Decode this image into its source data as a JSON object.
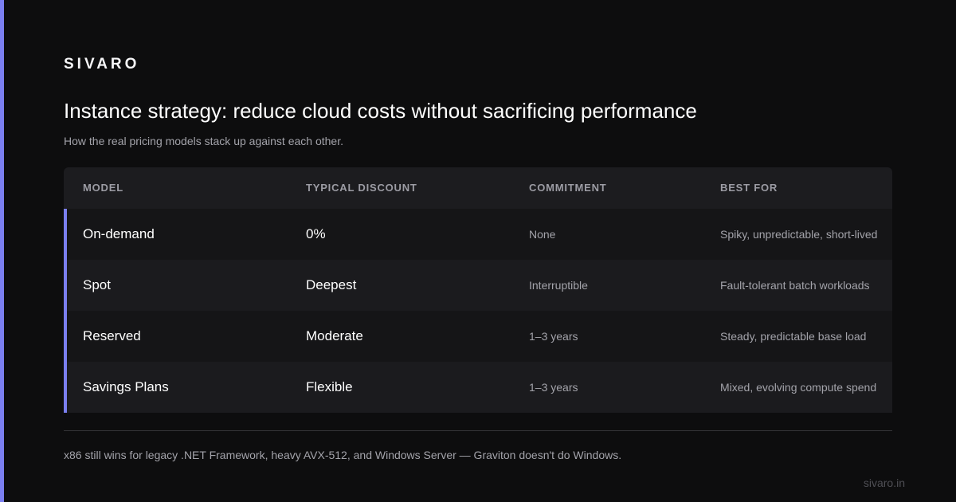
{
  "brand": "SIVARO",
  "title": "Instance strategy: reduce cloud costs without sacrificing performance",
  "subtitle": "How the real pricing models stack up against each other.",
  "colors": {
    "background": "#0d0d0e",
    "accent": "#7b7ff0",
    "header_bg": "#1c1c1f",
    "row_odd": "#151517",
    "row_even": "#1b1b1e"
  },
  "table": {
    "headers": [
      "MODEL",
      "TYPICAL DISCOUNT",
      "COMMITMENT",
      "BEST FOR"
    ],
    "rows": [
      {
        "model": "On-demand",
        "discount": "0%",
        "commitment": "None",
        "best_for": "Spiky, unpredictable, short-lived"
      },
      {
        "model": "Spot",
        "discount": "Deepest",
        "commitment": "Interruptible",
        "best_for": "Fault-tolerant batch workloads"
      },
      {
        "model": "Reserved",
        "discount": "Moderate",
        "commitment": "1–3 years",
        "best_for": "Steady, predictable base load"
      },
      {
        "model": "Savings Plans",
        "discount": "Flexible",
        "commitment": "1–3 years",
        "best_for": "Mixed, evolving compute spend"
      }
    ]
  },
  "footnote": "x86 still wins for legacy .NET Framework, heavy AVX-512, and Windows Server — Graviton doesn't do Windows.",
  "site": "sivaro.in"
}
